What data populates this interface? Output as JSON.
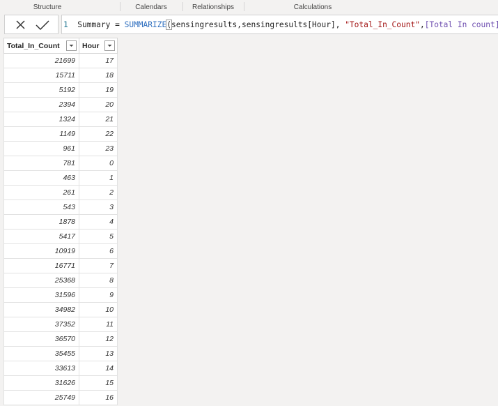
{
  "ribbon": {
    "groups": [
      "Structure",
      "Calendars",
      "Relationships",
      "Calculations"
    ]
  },
  "formula_bar": {
    "line_number": "1",
    "expression_tokens": [
      {
        "text": " Summary = ",
        "kind": "plain"
      },
      {
        "text": "SUMMARIZE",
        "kind": "fn"
      },
      {
        "text": "(",
        "kind": "paren"
      },
      {
        "text": "sensingresults,sensingresults[Hour], ",
        "kind": "plain"
      },
      {
        "text": "\"Total_In_Count\"",
        "kind": "str"
      },
      {
        "text": ",",
        "kind": "plain"
      },
      {
        "text": "[Total In count]",
        "kind": "meas"
      },
      {
        "text": ")",
        "kind": "paren"
      }
    ],
    "cancel_icon": "close-icon",
    "commit_icon": "checkmark-icon"
  },
  "table": {
    "columns": [
      "Total_In_Count",
      "Hour"
    ],
    "rows": [
      [
        "21699",
        "17"
      ],
      [
        "15711",
        "18"
      ],
      [
        "5192",
        "19"
      ],
      [
        "2394",
        "20"
      ],
      [
        "1324",
        "21"
      ],
      [
        "1149",
        "22"
      ],
      [
        "961",
        "23"
      ],
      [
        "781",
        "0"
      ],
      [
        "463",
        "1"
      ],
      [
        "261",
        "2"
      ],
      [
        "543",
        "3"
      ],
      [
        "1878",
        "4"
      ],
      [
        "5417",
        "5"
      ],
      [
        "10919",
        "6"
      ],
      [
        "16771",
        "7"
      ],
      [
        "25368",
        "8"
      ],
      [
        "31596",
        "9"
      ],
      [
        "34982",
        "10"
      ],
      [
        "37352",
        "11"
      ],
      [
        "36570",
        "12"
      ],
      [
        "35455",
        "13"
      ],
      [
        "33613",
        "14"
      ],
      [
        "31626",
        "15"
      ],
      [
        "25749",
        "16"
      ]
    ]
  }
}
